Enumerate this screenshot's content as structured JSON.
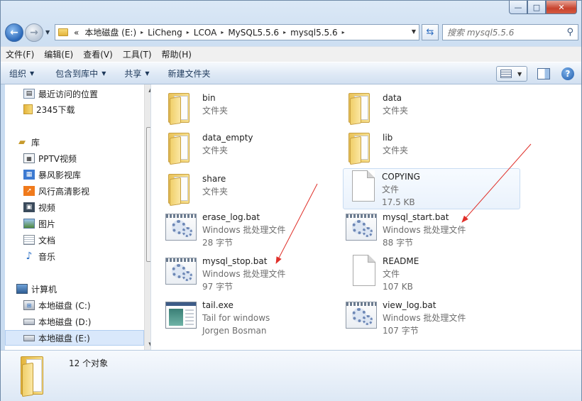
{
  "window": {
    "caption": {
      "minimize": "—",
      "maximize": "□",
      "close": "✕"
    }
  },
  "address": {
    "overflow": "«",
    "crumbs": [
      "本地磁盘 (E:)",
      "LiCheng",
      "LCOA",
      "MySQL5.5.6",
      "mysql5.5.6"
    ]
  },
  "search": {
    "placeholder": "搜索 mysql5.5.6"
  },
  "menu": [
    "文件(F)",
    "编辑(E)",
    "查看(V)",
    "工具(T)",
    "帮助(H)"
  ],
  "toolbar": {
    "organize": "组织",
    "include_in_library": "包含到库中",
    "share": "共享",
    "new_folder": "新建文件夹",
    "help": "?"
  },
  "nav": {
    "recent": "最近访问的位置",
    "downloads": "2345下载",
    "libraries": "库",
    "pptv": "PPTV视频",
    "baofeng": "暴风影视库",
    "fengxing": "风行高清影视",
    "videos": "视频",
    "pictures": "图片",
    "documents": "文档",
    "music": "音乐",
    "computer": "计算机",
    "drive_c": "本地磁盘 (C:)",
    "drive_d": "本地磁盘 (D:)",
    "drive_e": "本地磁盘 (E:)"
  },
  "files": [
    {
      "name": "bin",
      "line2": "文件夹",
      "line3": "",
      "icon": "folder-icon"
    },
    {
      "name": "data",
      "line2": "文件夹",
      "line3": "",
      "icon": "folder-icon"
    },
    {
      "name": "data_empty",
      "line2": "文件夹",
      "line3": "",
      "icon": "folder-icon"
    },
    {
      "name": "lib",
      "line2": "文件夹",
      "line3": "",
      "icon": "folder-icon"
    },
    {
      "name": "share",
      "line2": "文件夹",
      "line3": "",
      "icon": "folder-icon"
    },
    {
      "name": "COPYING",
      "line2": "文件",
      "line3": "17.5 KB",
      "icon": "document-icon"
    },
    {
      "name": "erase_log.bat",
      "line2": "Windows 批处理文件",
      "line3": "28 字节",
      "icon": "batch-file-icon"
    },
    {
      "name": "mysql_start.bat",
      "line2": "Windows 批处理文件",
      "line3": "88 字节",
      "icon": "batch-file-icon"
    },
    {
      "name": "mysql_stop.bat",
      "line2": "Windows 批处理文件",
      "line3": "97 字节",
      "icon": "batch-file-icon"
    },
    {
      "name": "README",
      "line2": "文件",
      "line3": "107 KB",
      "icon": "document-icon"
    },
    {
      "name": "tail.exe",
      "line2": "Tail for windows",
      "line3": "Jorgen Bosman",
      "icon": "application-icon"
    },
    {
      "name": "view_log.bat",
      "line2": "Windows 批处理文件",
      "line3": "107 字节",
      "icon": "batch-file-icon"
    }
  ],
  "status": {
    "count": "12 个对象"
  },
  "annotation_color": "#e0302a"
}
